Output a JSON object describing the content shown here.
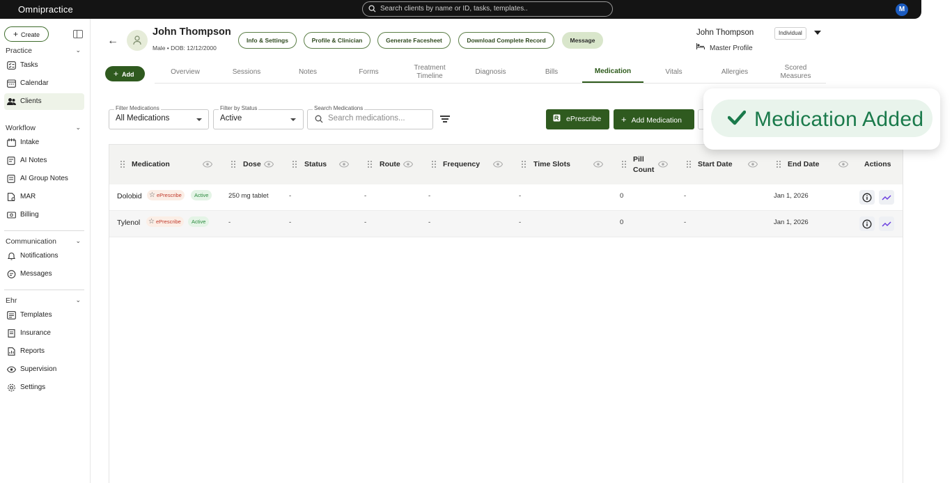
{
  "app": {
    "logo": "Omnipractice",
    "user_initial": "M"
  },
  "topbar": {
    "search_placeholder": "Search clients by name or ID, tasks, templates.."
  },
  "sidebar": {
    "create_label": "Create",
    "sections": [
      {
        "title": "Practice",
        "items": [
          "Tasks",
          "Calendar",
          "Clients"
        ]
      },
      {
        "title": "Workflow",
        "items": [
          "Intake",
          "AI Notes",
          "AI Group Notes",
          "MAR",
          "Billing"
        ]
      },
      {
        "title": "Communication",
        "items": [
          "Notifications",
          "Messages"
        ]
      },
      {
        "title": "Ehr",
        "items": [
          "Templates",
          "Insurance",
          "Reports",
          "Supervision",
          "Settings"
        ]
      }
    ]
  },
  "client": {
    "name": "John Thompson",
    "sub": "Male • DOB: 12/12/2000",
    "buttons": [
      "Info & Settings",
      "Profile & Clinician",
      "Generate Facesheet",
      "Download Complete Record",
      "Message"
    ],
    "right_name": "John Thompson",
    "right_badge": "Individual",
    "master_label": "Master Profile"
  },
  "tabs": {
    "add_label": "Add",
    "items": [
      "Overview",
      "Sessions",
      "Notes",
      "Forms",
      "Treatment Timeline",
      "Diagnosis",
      "Bills",
      "Medication",
      "Vitals",
      "Allergies",
      "Scored Measures"
    ],
    "active": "Medication"
  },
  "filters": {
    "medications_label": "Filter Medications",
    "medications_value": "All Medications",
    "status_label": "Filter by Status",
    "status_value": "Active",
    "search_label": "Search Medications",
    "search_placeholder": "Search medications..."
  },
  "actions": {
    "eprescribe": "ePrescribe",
    "add_medication": "Add Medication"
  },
  "toast": {
    "message": "Medication Added"
  },
  "table": {
    "columns": [
      "Medication",
      "Dose",
      "Status",
      "Route",
      "Frequency",
      "Time Slots",
      "Pill Count",
      "Start Date",
      "End Date",
      "Actions"
    ],
    "rows": [
      {
        "name": "Dolobid",
        "tag": "ePrescribe",
        "badge": "Active",
        "dose": "250 mg tablet",
        "status": "-",
        "route": "-",
        "frequency": "-",
        "time_slots": "-",
        "pill_count": "0",
        "start_date": "-",
        "end_date": "Jan 1, 2026"
      },
      {
        "name": "Tylenol",
        "tag": "ePrescribe",
        "badge": "Active",
        "dose": "-",
        "status": "-",
        "route": "-",
        "frequency": "-",
        "time_slots": "-",
        "pill_count": "0",
        "start_date": "-",
        "end_date": "Jan 1, 2026"
      }
    ]
  },
  "colors": {
    "brand_green": "#2f5a1f",
    "toast_green": "#1a7a4b",
    "topbar": "#141414"
  }
}
